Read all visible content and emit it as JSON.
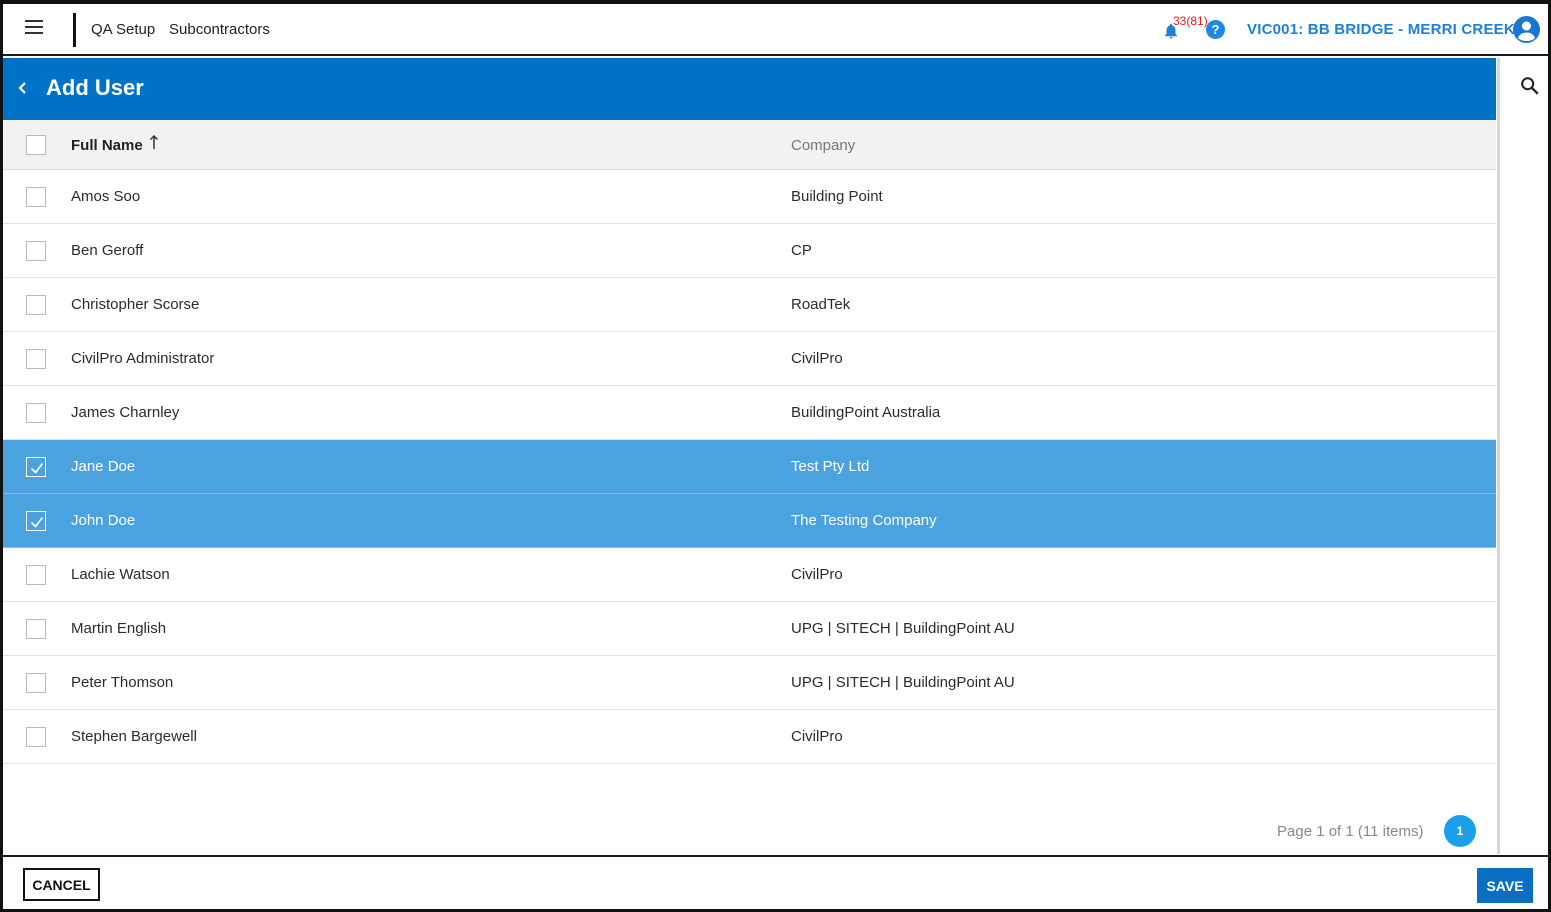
{
  "topbar": {
    "menu_icon": "hamburger-menu-icon",
    "breadcrumbs": [
      "QA Setup",
      "Subcontractors"
    ],
    "notification_count": "33(81)",
    "help_label": "?",
    "project": "VIC001: BB BRIDGE - MERRI CREEK",
    "accent": "#1e7fd8"
  },
  "header": {
    "title": "Add User",
    "band_color": "#0072c6"
  },
  "grid": {
    "columns": {
      "full_name": "Full Name",
      "company": "Company"
    },
    "sort": "ascending",
    "rows": [
      {
        "name": "Amos Soo",
        "company": "Building Point",
        "selected": false
      },
      {
        "name": "Ben Geroff",
        "company": "CP",
        "selected": false
      },
      {
        "name": "Christopher Scorse",
        "company": "RoadTek",
        "selected": false
      },
      {
        "name": "CivilPro Administrator",
        "company": "CivilPro",
        "selected": false
      },
      {
        "name": "James Charnley",
        "company": "BuildingPoint Australia",
        "selected": false
      },
      {
        "name": "Jane Doe",
        "company": "Test Pty Ltd",
        "selected": true
      },
      {
        "name": "John Doe",
        "company": "The Testing Company",
        "selected": true
      },
      {
        "name": "Lachie Watson",
        "company": "CivilPro",
        "selected": false
      },
      {
        "name": "Martin English",
        "company": "UPG | SITECH | BuildingPoint AU",
        "selected": false
      },
      {
        "name": "Peter Thomson",
        "company": "UPG | SITECH | BuildingPoint AU",
        "selected": false
      },
      {
        "name": "Stephen Bargewell",
        "company": "CivilPro",
        "selected": false
      }
    ],
    "selected_color": "#4aa3df"
  },
  "pager": {
    "info": "Page 1 of 1 (11 items)",
    "current_page": "1"
  },
  "footer": {
    "cancel_label": "CANCEL",
    "save_label": "SAVE"
  }
}
